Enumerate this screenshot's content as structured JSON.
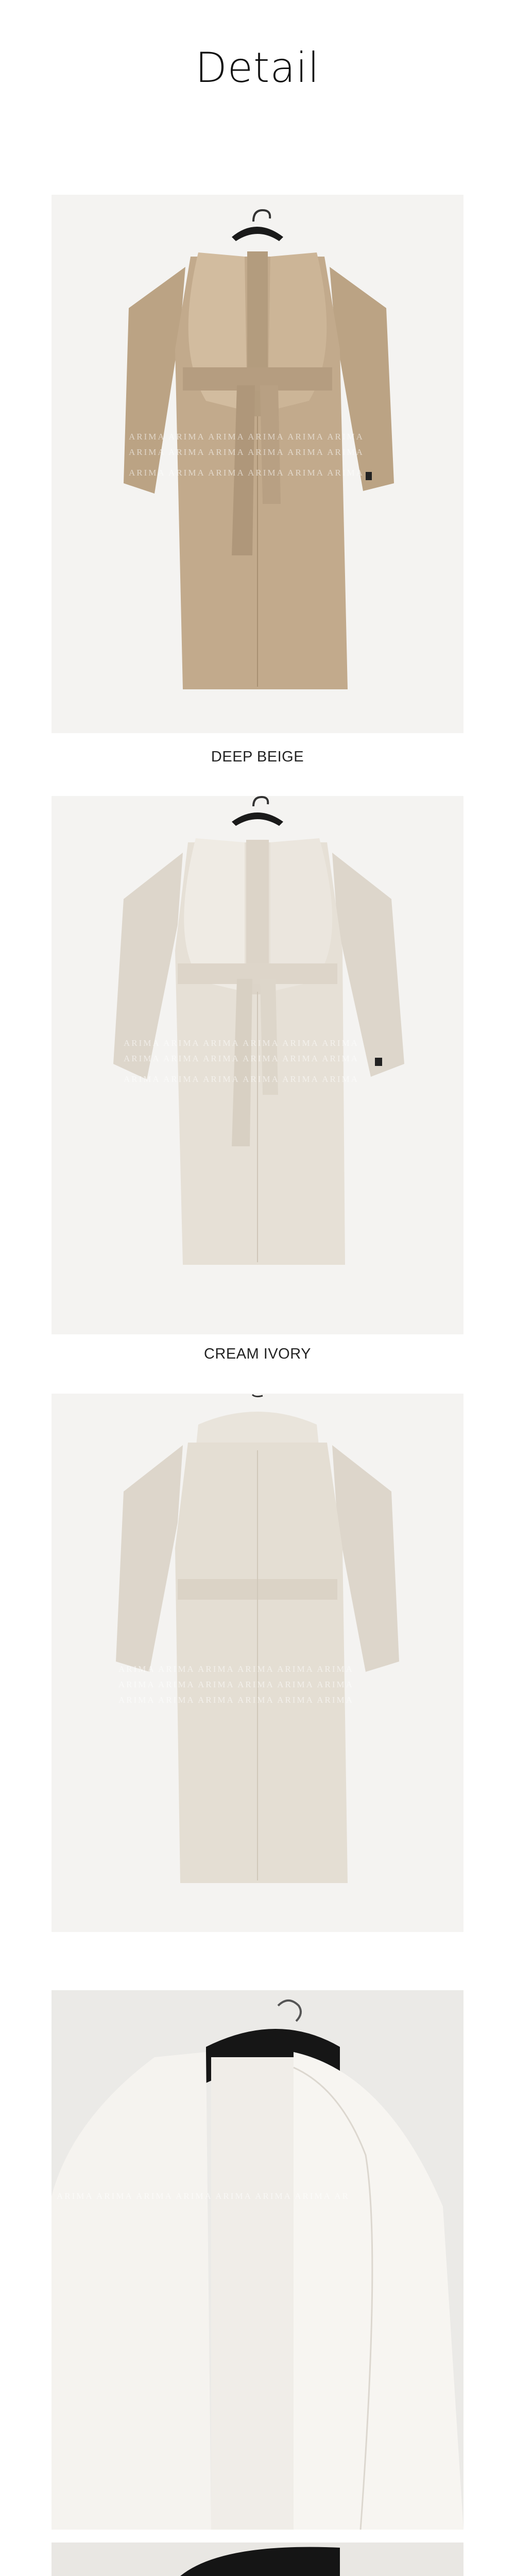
{
  "header": {
    "title": "Detail"
  },
  "products": [
    {
      "caption": "DEEP BEIGE"
    },
    {
      "caption": "CREAM IVORY"
    },
    {
      "caption": ""
    }
  ],
  "watermark": {
    "text": "ARIMA ARIMA ARIMA"
  },
  "colors": {
    "deep_beige": "#c2aa8c",
    "cream_ivory": "#e6e0d6",
    "background": "#f3f3f1"
  }
}
